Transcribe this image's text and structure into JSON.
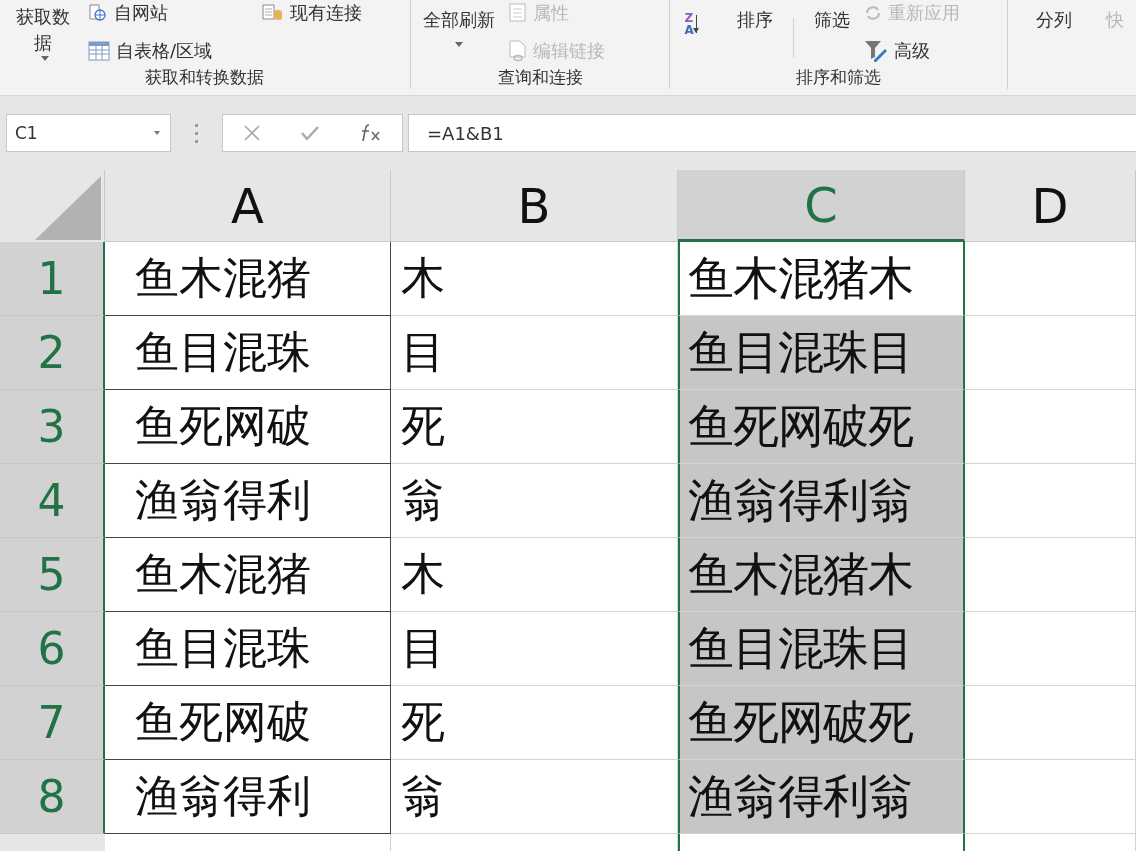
{
  "ribbon": {
    "groups": [
      {
        "label": "获取和转换数据",
        "columns": [
          [
            {
              "kind": "large",
              "label": "获取数据",
              "caret": true,
              "disabled": false
            }
          ],
          [
            {
              "kind": "small",
              "label": "自网站",
              "disabled": false
            },
            {
              "kind": "small",
              "label": "自表格/区域",
              "disabled": false
            }
          ],
          [
            {
              "kind": "small",
              "label": "现有连接",
              "disabled": false
            }
          ]
        ]
      },
      {
        "label": "查询和连接",
        "columns": [
          [
            {
              "kind": "large",
              "label": "全部刷新",
              "caret": true,
              "disabled": false
            }
          ],
          [
            {
              "kind": "small",
              "label": "属性",
              "disabled": true
            },
            {
              "kind": "small",
              "label": "编辑链接",
              "disabled": true
            }
          ]
        ]
      },
      {
        "label": "排序和筛选",
        "columns": [
          [
            {
              "kind": "icon",
              "glyphs": [
                "Z",
                "A"
              ],
              "disabled": false
            }
          ],
          [
            {
              "kind": "large",
              "label": "排序",
              "disabled": false
            }
          ],
          [
            {
              "kind": "large",
              "label": "筛选",
              "disabled": false
            }
          ],
          [
            {
              "kind": "small",
              "label": "重新应用",
              "disabled": true
            },
            {
              "kind": "small",
              "label": "高级",
              "disabled": false
            }
          ]
        ]
      },
      {
        "columns": [
          [
            {
              "kind": "large",
              "label": "分列",
              "disabled": false
            }
          ],
          [
            {
              "kind": "large",
              "label": "快",
              "disabled": true
            }
          ]
        ]
      }
    ]
  },
  "formula_bar": {
    "name_box": "C1",
    "formula": "=A1&B1"
  },
  "sheet": {
    "columns": [
      {
        "label": "A",
        "selected": false
      },
      {
        "label": "B",
        "selected": false
      },
      {
        "label": "C",
        "selected": true
      },
      {
        "label": "D",
        "selected": false
      }
    ],
    "rows": [
      {
        "header": "1",
        "selected": true,
        "cells": [
          {
            "value": "鱼木混猪",
            "selected": false
          },
          {
            "value": "木",
            "selected": false
          },
          {
            "value": "鱼木混猪木",
            "selected": false
          }
        ]
      },
      {
        "header": "2",
        "selected": true,
        "cells": [
          {
            "value": "鱼目混珠",
            "selected": false
          },
          {
            "value": "目",
            "selected": false
          },
          {
            "value": "鱼目混珠目",
            "selected": true
          }
        ]
      },
      {
        "header": "3",
        "selected": true,
        "cells": [
          {
            "value": "鱼死网破",
            "selected": false
          },
          {
            "value": "死",
            "selected": false
          },
          {
            "value": "鱼死网破死",
            "selected": true
          }
        ]
      },
      {
        "header": "4",
        "selected": true,
        "cells": [
          {
            "value": "渔翁得利",
            "selected": false
          },
          {
            "value": "翁",
            "selected": false
          },
          {
            "value": "渔翁得利翁",
            "selected": true
          }
        ]
      },
      {
        "header": "5",
        "selected": true,
        "cells": [
          {
            "value": "鱼木混猪",
            "selected": false
          },
          {
            "value": "木",
            "selected": false
          },
          {
            "value": "鱼木混猪木",
            "selected": true
          }
        ]
      },
      {
        "header": "6",
        "selected": true,
        "cells": [
          {
            "value": "鱼目混珠",
            "selected": false
          },
          {
            "value": "目",
            "selected": false
          },
          {
            "value": "鱼目混珠目",
            "selected": true
          }
        ]
      },
      {
        "header": "7",
        "selected": true,
        "cells": [
          {
            "value": "鱼死网破",
            "selected": false
          },
          {
            "value": "死",
            "selected": false
          },
          {
            "value": "鱼死网破死",
            "selected": true
          }
        ]
      },
      {
        "header": "8",
        "selected": true,
        "cells": [
          {
            "value": "渔翁得利",
            "selected": false
          },
          {
            "value": "翁",
            "selected": false
          },
          {
            "value": "渔翁得利翁",
            "selected": true
          }
        ]
      }
    ]
  }
}
